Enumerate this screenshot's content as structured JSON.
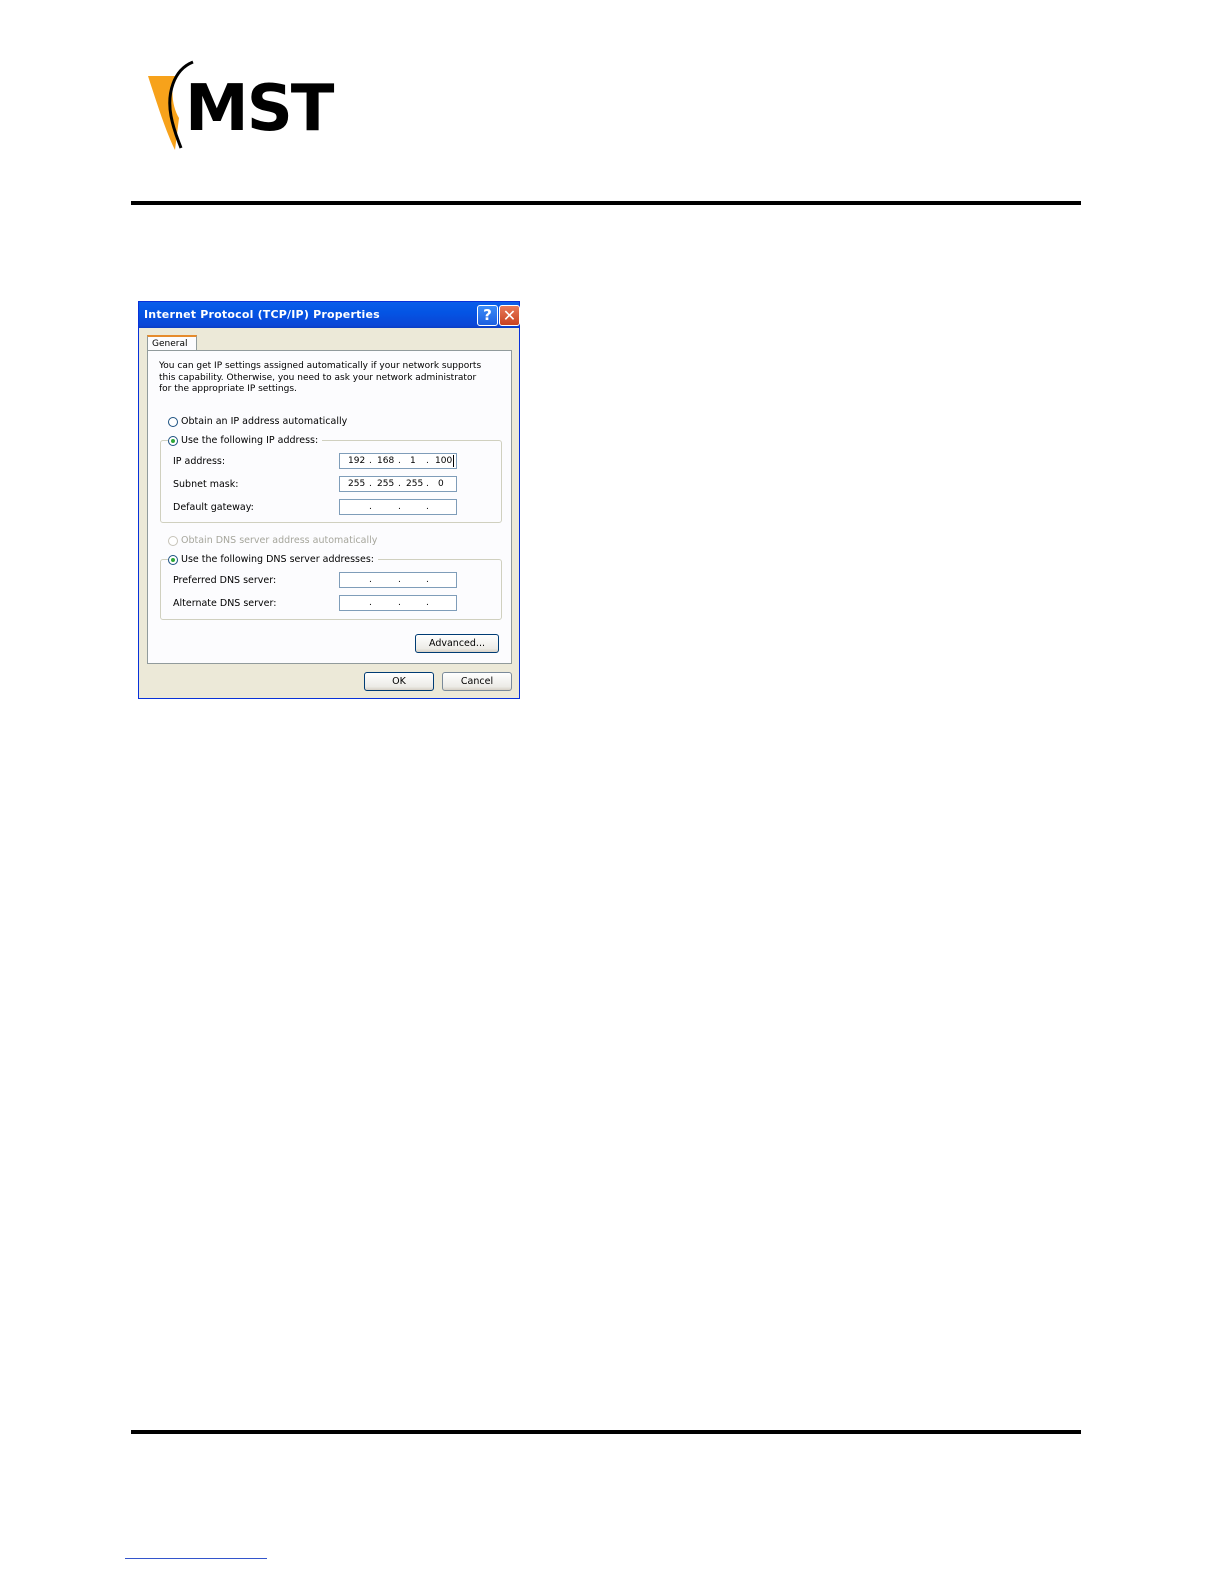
{
  "brand": {
    "logo_text": "MST",
    "accent_color": "#f7a21b"
  },
  "dialog": {
    "title": "Internet Protocol (TCP/IP) Properties",
    "help_icon": "?",
    "close_icon": "✕",
    "tab_general": "General",
    "description": "You can get IP settings assigned automatically if your network supports this capability. Otherwise, you need to ask your network administrator for the appropriate IP settings.",
    "ip_auto_label": "Obtain an IP address automatically",
    "ip_manual_label": "Use the following IP address:",
    "ip_address_label": "IP address:",
    "ip_address": [
      "192",
      "168",
      "1",
      "100"
    ],
    "subnet_label": "Subnet mask:",
    "subnet": [
      "255",
      "255",
      "255",
      "0"
    ],
    "gateway_label": "Default gateway:",
    "dns_auto_label": "Obtain DNS server address automatically",
    "dns_manual_label": "Use the following DNS server addresses:",
    "preferred_dns_label": "Preferred DNS server:",
    "alternate_dns_label": "Alternate DNS server:",
    "advanced_label": "Advanced...",
    "ok_label": "OK",
    "cancel_label": "Cancel",
    "separator_dot": "."
  }
}
